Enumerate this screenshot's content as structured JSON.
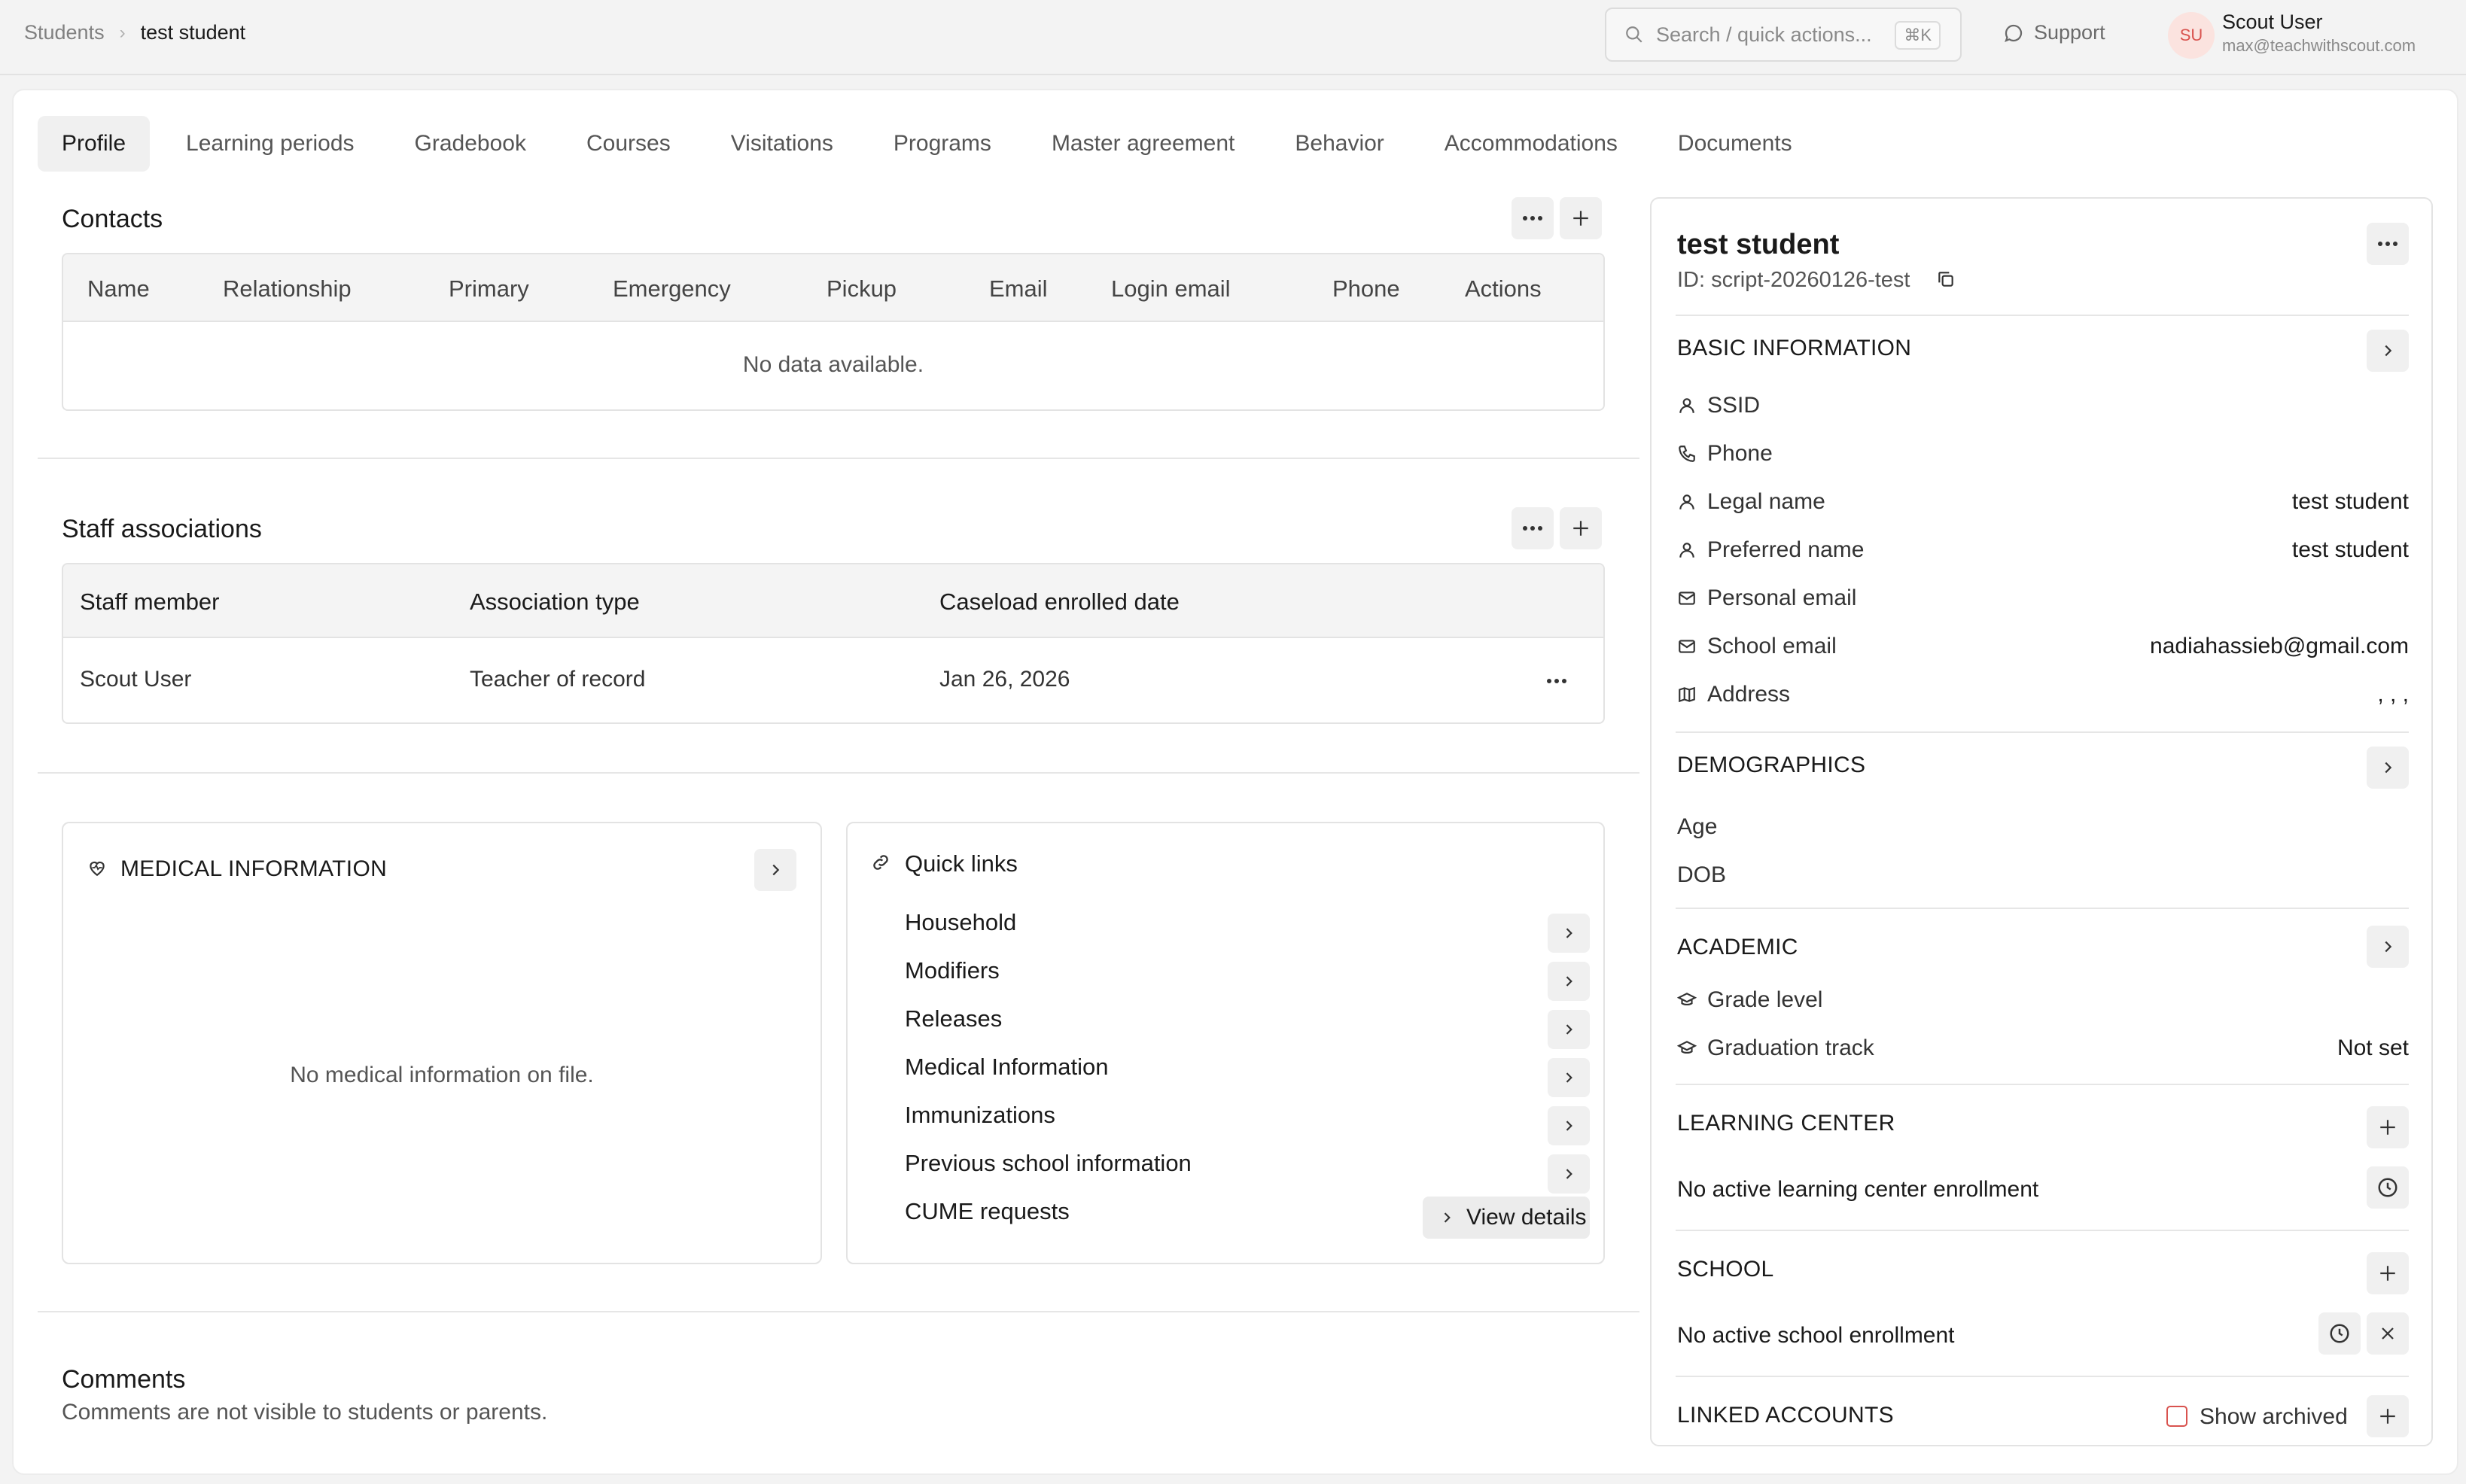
{
  "breadcrumb": {
    "root": "Students",
    "current": "test student"
  },
  "search": {
    "placeholder": "Search / quick actions...",
    "shortcut": "⌘K"
  },
  "support": {
    "label": "Support"
  },
  "user": {
    "initials": "SU",
    "name": "Scout User",
    "email": "max@teachwithscout.com"
  },
  "tabs": [
    "Profile",
    "Learning periods",
    "Gradebook",
    "Courses",
    "Visitations",
    "Programs",
    "Master agreement",
    "Behavior",
    "Accommodations",
    "Documents"
  ],
  "contacts": {
    "title": "Contacts",
    "columns": [
      "Name",
      "Relationship",
      "Primary",
      "Emergency",
      "Pickup",
      "Email",
      "Login email",
      "Phone",
      "Actions"
    ],
    "empty": "No data available."
  },
  "staff": {
    "title": "Staff associations",
    "columns": [
      "Staff member",
      "Association type",
      "Caseload enrolled date"
    ],
    "rows": [
      {
        "member": "Scout User",
        "type": "Teacher of record",
        "date": "Jan 26, 2026"
      }
    ]
  },
  "medical": {
    "title": "MEDICAL INFORMATION",
    "empty": "No medical information on file."
  },
  "quick_links": {
    "title": "Quick links",
    "items": [
      "Household",
      "Modifiers",
      "Releases",
      "Medical Information",
      "Immunizations",
      "Previous school information",
      "CUME requests"
    ],
    "view_details": "View details"
  },
  "comments": {
    "title": "Comments",
    "subtitle": "Comments are not visible to students or parents."
  },
  "student": {
    "name": "test student",
    "id": "ID: script-20260126-test",
    "basic": {
      "title": "BASIC INFORMATION",
      "fields": [
        {
          "label": "SSID",
          "value": "",
          "icon": "user-icon"
        },
        {
          "label": "Phone",
          "value": "",
          "icon": "phone-icon"
        },
        {
          "label": "Legal name",
          "value": "test student",
          "icon": "user-icon"
        },
        {
          "label": "Preferred name",
          "value": "test student",
          "icon": "user-icon"
        },
        {
          "label": "Personal email",
          "value": "",
          "icon": "mail-icon"
        },
        {
          "label": "School email",
          "value": "nadiahassieb@gmail.com",
          "icon": "mail-icon"
        },
        {
          "label": "Address",
          "value": ", , ,",
          "icon": "map-icon"
        }
      ]
    },
    "demographics": {
      "title": "DEMOGRAPHICS",
      "fields": [
        "Age",
        "DOB"
      ]
    },
    "academic": {
      "title": "ACADEMIC",
      "fields": [
        {
          "label": "Grade level",
          "value": ""
        },
        {
          "label": "Graduation track",
          "value": "Not set"
        }
      ]
    },
    "learning_center": {
      "title": "LEARNING CENTER",
      "status": "No active learning center enrollment"
    },
    "school": {
      "title": "SCHOOL",
      "status": "No active school enrollment"
    },
    "linked": {
      "title": "LINKED ACCOUNTS",
      "show_archived": "Show archived"
    }
  },
  "colors": {
    "accent": "#d9534f",
    "border": "#e3e3e3",
    "header_bg": "#f4f4f4"
  }
}
